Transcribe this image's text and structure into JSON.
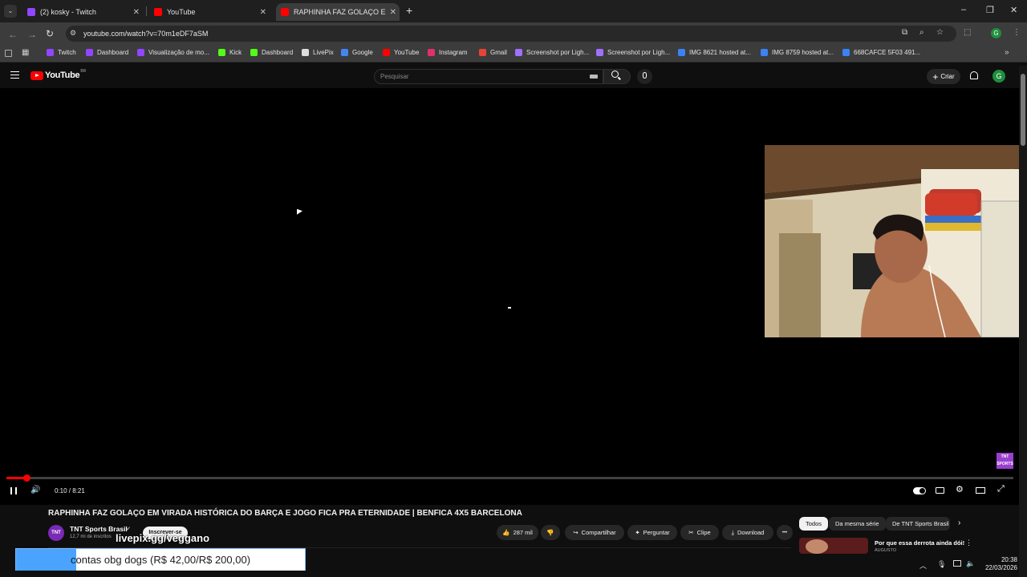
{
  "browser": {
    "tabs": [
      {
        "title": "(2) kosky - Twitch",
        "icon": "twitch-icon",
        "active": false
      },
      {
        "title": "YouTube",
        "icon": "youtube-icon",
        "active": false
      },
      {
        "title": "RAPHINHA FAZ GOLAÇO EM V",
        "icon": "youtube-icon",
        "active": true
      }
    ],
    "new_tab": "+",
    "window_controls": {
      "minimize": "–",
      "restore": "❐",
      "close": "✕"
    },
    "url": "youtube.com/watch?v=70m1eDF7aSM",
    "bookmarks": [
      {
        "label": "Twitch",
        "color": "#9146ff"
      },
      {
        "label": "Dashboard",
        "color": "#9146ff"
      },
      {
        "label": "Visualização de mo...",
        "color": "#9146ff"
      },
      {
        "label": "Kick",
        "color": "#53fc18"
      },
      {
        "label": "Dashboard",
        "color": "#53fc18"
      },
      {
        "label": "LivePix",
        "color": "#dddddd"
      },
      {
        "label": "Google",
        "color": "#4285f4"
      },
      {
        "label": "YouTube",
        "color": "#ff0000"
      },
      {
        "label": "Instagram",
        "color": "#e1306c"
      },
      {
        "label": "Gmail",
        "color": "#ea4335"
      },
      {
        "label": "Screenshot por Ligh...",
        "color": "#a070ff"
      },
      {
        "label": "Screenshot por Ligh...",
        "color": "#a070ff"
      },
      {
        "label": "IMG 8621 hosted at...",
        "color": "#3b82f6"
      },
      {
        "label": "IMG 8759 hosted at...",
        "color": "#3b82f6"
      },
      {
        "label": "668CAFCE 5F03 491...",
        "color": "#3b82f6"
      }
    ],
    "more_bookmarks": "»"
  },
  "youtube": {
    "logo": "YouTube",
    "logo_suffix": "BR",
    "search_placeholder": "Pesquisar",
    "create_label": "Criar",
    "avatar_letter": "G",
    "video_title": "RAPHINHA FAZ GOLAÇO EM VIRADA HISTÓRICA DO BARÇA E JOGO FICA PRA ETERNIDADE | BENFICA 4X5 BARCELONA",
    "time_display": "0:10 / 8:21",
    "progress_fraction": 0.02,
    "watermark": "TNT SPORTS",
    "channel": {
      "name": "TNT Sports Brasil",
      "subscribers": "12,7 mi de inscritos",
      "subscribe_label": "Inscrever-se",
      "logo_text": "TNT"
    },
    "actions": {
      "likes": "287 mil",
      "share": "Compartilhar",
      "ask": "Perguntar",
      "clip": "Clipe",
      "download": "Download",
      "more": "•••"
    },
    "chips": [
      "Todos",
      "Da mesma série",
      "De TNT Sports Brasil"
    ],
    "recommendation": {
      "title": "Por que essa derrota ainda dói!",
      "meta": "AUGUSTO"
    }
  },
  "overlay": {
    "livepix": "livepix.gg/veggano",
    "donation": "contas obg dogs (R$ 42,00/R$ 200,00)"
  },
  "taskbar": {
    "time": "20:38",
    "date": "22/03/2026"
  },
  "colors": {
    "accent_red": "#ff0000",
    "background": "#0f0f0f"
  }
}
